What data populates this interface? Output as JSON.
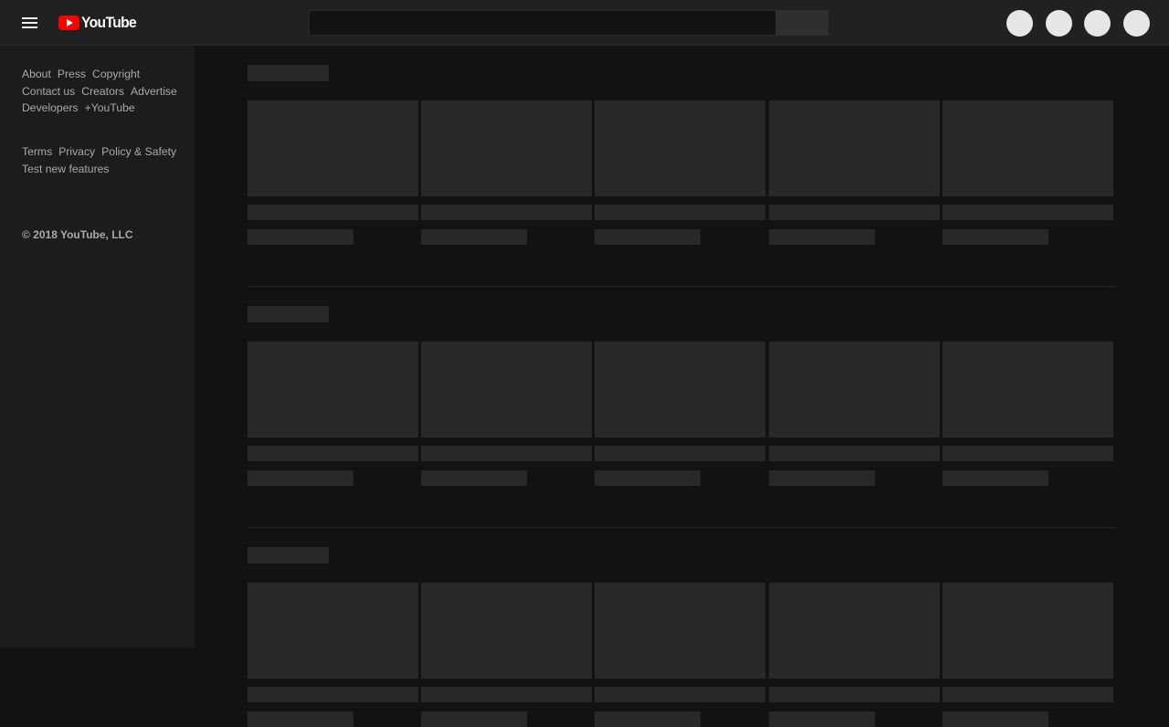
{
  "masthead": {
    "logo_text": "YouTube",
    "search": {
      "value": "",
      "placeholder": ""
    }
  },
  "guide": {
    "links_primary": [
      "About",
      "Press",
      "Copyright",
      "Contact us",
      "Creators",
      "Advertise",
      "Developers",
      "+YouTube"
    ],
    "links_secondary": [
      "Terms",
      "Privacy",
      "Policy & Safety",
      "Test new features"
    ],
    "copyright": "© 2018 YouTube, LLC"
  },
  "colors": {
    "page_bg": "#121212",
    "masthead_bg": "#212121",
    "guide_bg": "#1c1c1c",
    "placeholder": "#282828",
    "logo_red": "#ff0000"
  },
  "icons": [
    "menu-icon",
    "youtube-logo-icon"
  ]
}
